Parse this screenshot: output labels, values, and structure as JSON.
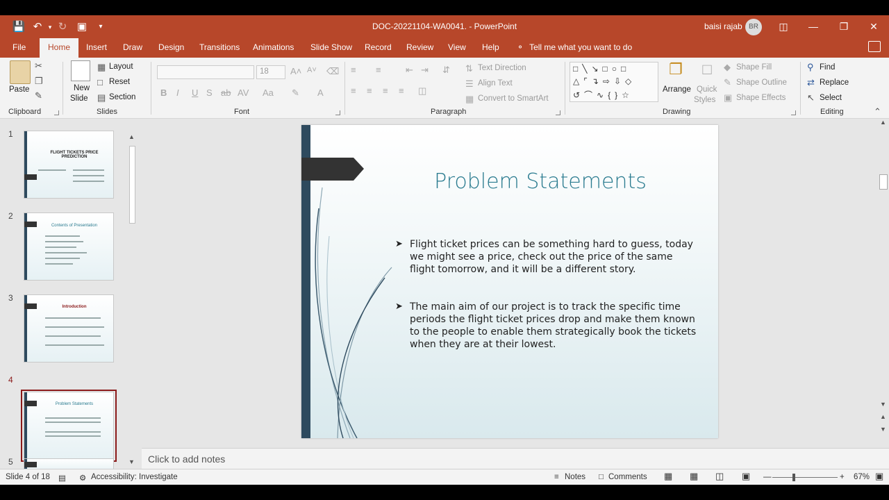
{
  "title_bar": {
    "document_title": "DOC-20221104-WA0041.  -  PowerPoint",
    "user_name": "baisi rajab",
    "user_initials": "BR",
    "accent_color": "#b7472a"
  },
  "tabs": [
    {
      "label": "File"
    },
    {
      "label": "Home"
    },
    {
      "label": "Insert"
    },
    {
      "label": "Draw"
    },
    {
      "label": "Design"
    },
    {
      "label": "Transitions"
    },
    {
      "label": "Animations"
    },
    {
      "label": "Slide Show"
    },
    {
      "label": "Record"
    },
    {
      "label": "Review"
    },
    {
      "label": "View"
    },
    {
      "label": "Help"
    }
  ],
  "tell_me": "Tell me what you want to do",
  "ribbon": {
    "clipboard": {
      "paste": "Paste",
      "label": "Clipboard"
    },
    "slides": {
      "new_slide_1": "New",
      "new_slide_2": "Slide",
      "layout": "Layout",
      "reset": "Reset",
      "section": "Section",
      "label": "Slides"
    },
    "font": {
      "size": "18",
      "label": "Font"
    },
    "paragraph": {
      "text_direction": "Text Direction",
      "align_text": "Align Text",
      "convert_smartart": "Convert to SmartArt",
      "label": "Paragraph"
    },
    "drawing": {
      "arrange": "Arrange",
      "quick_styles_1": "Quick",
      "quick_styles_2": "Styles",
      "shape_fill": "Shape Fill",
      "shape_outline": "Shape Outline",
      "shape_effects": "Shape Effects",
      "label": "Drawing"
    },
    "editing": {
      "find": "Find",
      "replace": "Replace",
      "select": "Select",
      "label": "Editing"
    }
  },
  "thumbnails": [
    {
      "number": "1",
      "title": "FLIGHT TICKETS PRICE PREDICTION"
    },
    {
      "number": "2",
      "title": "Contents of Presentation"
    },
    {
      "number": "3",
      "title": "Introduction"
    },
    {
      "number": "4",
      "title": "Problem Statements"
    },
    {
      "number": "5",
      "title": ""
    }
  ],
  "slide": {
    "title": "Problem Statements",
    "bullets": [
      "Flight ticket prices can be something hard to guess, today we might see a price, check out the price of the same flight tomorrow, and it will be a different story.",
      "The main aim of our project is to track the specific time periods the flight ticket prices drop and make them known to the people to enable them strategically book the tickets when they are at their lowest."
    ],
    "title_color": "#2a7b8f"
  },
  "notes_placeholder": "Click to add notes",
  "status": {
    "slide_counter": "Slide 4 of 18",
    "accessibility": "Accessibility: Investigate",
    "notes": "Notes",
    "comments": "Comments",
    "zoom": "67%"
  }
}
